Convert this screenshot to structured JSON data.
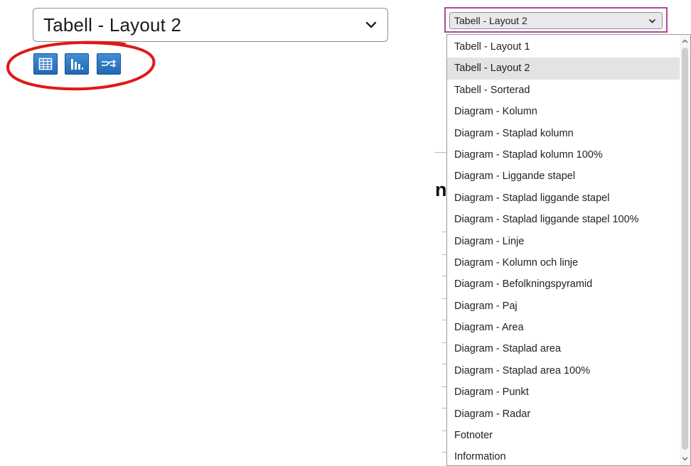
{
  "left_select": {
    "value": "Tabell - Layout 2"
  },
  "view_buttons": [
    {
      "name": "table-view-button",
      "icon": "table-icon"
    },
    {
      "name": "chart-view-button",
      "icon": "bar-chart-icon"
    },
    {
      "name": "pivot-view-button",
      "icon": "pivot-icon"
    }
  ],
  "right_select": {
    "value": "Tabell - Layout 2",
    "options": [
      "Tabell - Layout 1",
      "Tabell - Layout 2",
      "Tabell - Sorterad",
      "Diagram - Kolumn",
      "Diagram - Staplad kolumn",
      "Diagram - Staplad kolumn 100%",
      "Diagram - Liggande stapel",
      "Diagram - Staplad liggande stapel",
      "Diagram - Staplad liggande stapel 100%",
      "Diagram - Linje",
      "Diagram - Kolumn och linje",
      "Diagram - Befolkningspyramid",
      "Diagram - Paj",
      "Diagram - Area",
      "Diagram - Staplad area",
      "Diagram - Staplad area 100%",
      "Diagram - Punkt",
      "Diagram - Radar",
      "Fotnoter",
      "Information"
    ],
    "selected_index": 1
  },
  "background": {
    "partial_heading": "n"
  },
  "colors": {
    "icon_button_blue": "#2a74c0",
    "highlight_ring": "#e01818",
    "focus_border": "#b0489a",
    "selected_option_bg": "#e3e3e6"
  }
}
